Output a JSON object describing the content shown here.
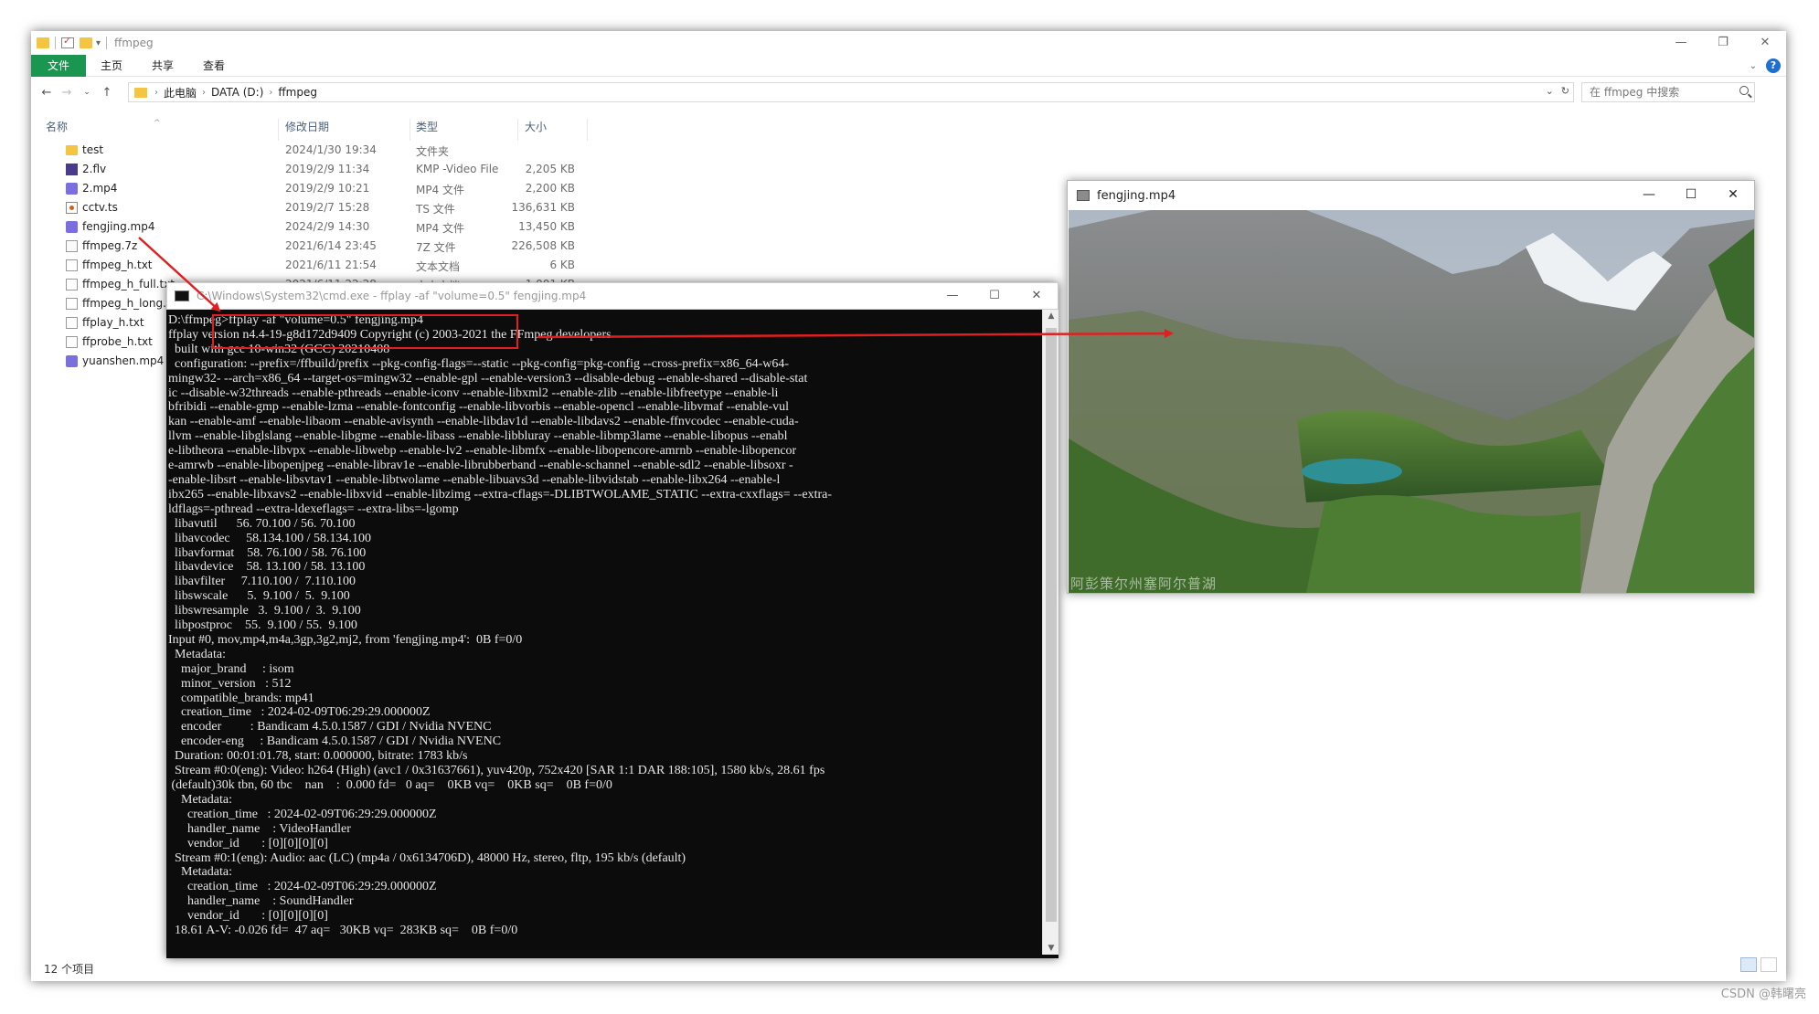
{
  "explorer": {
    "title": "ffmpeg",
    "window_controls": [
      "—",
      "❐",
      "✕"
    ],
    "ribbon_tabs": [
      "文件",
      "主页",
      "共享",
      "查看"
    ],
    "breadcrumb": [
      "此电脑",
      "DATA (D:)",
      "ffmpeg"
    ],
    "search_placeholder": "在 ffmpeg 中搜索",
    "columns": {
      "name": "名称",
      "date": "修改日期",
      "type": "类型",
      "size": "大小"
    },
    "files": [
      {
        "name": "test",
        "date": "2024/1/30 19:34",
        "type": "文件夹",
        "size": "",
        "icon": "folder-icon"
      },
      {
        "name": "2.flv",
        "date": "2019/2/9 11:34",
        "type": "KMP -Video File",
        "size": "2,205 KB",
        "icon": "video-file-icon"
      },
      {
        "name": "2.mp4",
        "date": "2019/2/9 10:21",
        "type": "MP4 文件",
        "size": "2,200 KB",
        "icon": "mp4-file-icon"
      },
      {
        "name": "cctv.ts",
        "date": "2019/2/7 15:28",
        "type": "TS 文件",
        "size": "136,631 KB",
        "icon": "ts-file-icon"
      },
      {
        "name": "fengjing.mp4",
        "date": "2024/2/9 14:30",
        "type": "MP4 文件",
        "size": "13,450 KB",
        "icon": "mp4-file-icon"
      },
      {
        "name": "ffmpeg.7z",
        "date": "2021/6/14 23:45",
        "type": "7Z 文件",
        "size": "226,508 KB",
        "icon": "archive-file-icon"
      },
      {
        "name": "ffmpeg_h.txt",
        "date": "2021/6/11 21:54",
        "type": "文本文档",
        "size": "6 KB",
        "icon": "text-file-icon"
      },
      {
        "name": "ffmpeg_h_full.txt",
        "date": "2021/6/11 22:28",
        "type": "文本文档",
        "size": "1,001 KB",
        "icon": "text-file-icon"
      },
      {
        "name": "ffmpeg_h_long.txt",
        "date": "",
        "type": "",
        "size": "",
        "icon": "text-file-icon"
      },
      {
        "name": "ffplay_h.txt",
        "date": "",
        "type": "",
        "size": "",
        "icon": "text-file-icon"
      },
      {
        "name": "ffprobe_h.txt",
        "date": "",
        "type": "",
        "size": "",
        "icon": "text-file-icon"
      },
      {
        "name": "yuanshen.mp4",
        "date": "",
        "type": "",
        "size": "",
        "icon": "mp4-file-icon"
      }
    ],
    "status": "12 个项目"
  },
  "cmd": {
    "title": "C:\\Windows\\System32\\cmd.exe - ffplay  -af \"volume=0.5\" fengjing.mp4",
    "window_controls": [
      "—",
      "☐",
      "✕"
    ],
    "lines": [
      "D:\\ffmpeg>ffplay -af \"volume=0.5\" fengjing.mp4",
      "ffplay version n4.4-19-g8d172d9409 Copyright (c) 2003-2021 the FFmpeg developers",
      "  built with gcc 10-win32 (GCC) 20210408",
      "  configuration: --prefix=/ffbuild/prefix --pkg-config-flags=--static --pkg-config=pkg-config --cross-prefix=x86_64-w64-",
      "mingw32- --arch=x86_64 --target-os=mingw32 --enable-gpl --enable-version3 --disable-debug --enable-shared --disable-stat",
      "ic --disable-w32threads --enable-pthreads --enable-iconv --enable-libxml2 --enable-zlib --enable-libfreetype --enable-li",
      "bfribidi --enable-gmp --enable-lzma --enable-fontconfig --enable-libvorbis --enable-opencl --enable-libvmaf --enable-vul",
      "kan --enable-amf --enable-libaom --enable-avisynth --enable-libdav1d --enable-libdavs2 --enable-ffnvcodec --enable-cuda-",
      "llvm --enable-libglslang --enable-libgme --enable-libass --enable-libbluray --enable-libmp3lame --enable-libopus --enabl",
      "e-libtheora --enable-libvpx --enable-libwebp --enable-lv2 --enable-libmfx --enable-libopencore-amrnb --enable-libopencor",
      "e-amrwb --enable-libopenjpeg --enable-librav1e --enable-librubberband --enable-schannel --enable-sdl2 --enable-libsoxr -",
      "-enable-libsrt --enable-libsvtav1 --enable-libtwolame --enable-libuavs3d --enable-libvidstab --enable-libx264 --enable-l",
      "ibx265 --enable-libxavs2 --enable-libxvid --enable-libzimg --extra-cflags=-DLIBTWOLAME_STATIC --extra-cxxflags= --extra-",
      "ldflags=-pthread --extra-ldexeflags= --extra-libs=-lgomp",
      "  libavutil      56. 70.100 / 56. 70.100",
      "  libavcodec     58.134.100 / 58.134.100",
      "  libavformat    58. 76.100 / 58. 76.100",
      "  libavdevice    58. 13.100 / 58. 13.100",
      "  libavfilter     7.110.100 /  7.110.100",
      "  libswscale      5.  9.100 /  5.  9.100",
      "  libswresample   3.  9.100 /  3.  9.100",
      "  libpostproc    55.  9.100 / 55.  9.100",
      "Input #0, mov,mp4,m4a,3gp,3g2,mj2, from 'fengjing.mp4':  0B f=0/0",
      "  Metadata:",
      "    major_brand     : isom",
      "    minor_version   : 512",
      "    compatible_brands: mp41",
      "    creation_time   : 2024-02-09T06:29:29.000000Z",
      "    encoder         : Bandicam 4.5.0.1587 / GDI / Nvidia NVENC",
      "    encoder-eng     : Bandicam 4.5.0.1587 / GDI / Nvidia NVENC",
      "  Duration: 00:01:01.78, start: 0.000000, bitrate: 1783 kb/s",
      "  Stream #0:0(eng): Video: h264 (High) (avc1 / 0x31637661), yuv420p, 752x420 [SAR 1:1 DAR 188:105], 1580 kb/s, 28.61 fps",
      " (default)30k tbn, 60 tbc    nan    :  0.000 fd=   0 aq=    0KB vq=    0KB sq=    0B f=0/0",
      "    Metadata:",
      "      creation_time   : 2024-02-09T06:29:29.000000Z",
      "      handler_name    : VideoHandler",
      "      vendor_id       : [0][0][0][0]",
      "  Stream #0:1(eng): Audio: aac (LC) (mp4a / 0x6134706D), 48000 Hz, stereo, fltp, 195 kb/s (default)",
      "    Metadata:",
      "      creation_time   : 2024-02-09T06:29:29.000000Z",
      "      handler_name    : SoundHandler",
      "      vendor_id       : [0][0][0][0]",
      "  18.61 A-V: -0.026 fd=  47 aq=   30KB vq=  283KB sq=    0B f=0/0"
    ]
  },
  "video": {
    "title": "fengjing.mp4",
    "window_controls": [
      "—",
      "☐",
      "✕"
    ],
    "caption": "阿彭策尔州塞阿尔普湖"
  },
  "watermark": "CSDN @韩曙亮",
  "colors": {
    "ribbon_file_tab": "#1a9650",
    "annotation_red": "#e02020",
    "console_bg": "#0c0c0c"
  }
}
